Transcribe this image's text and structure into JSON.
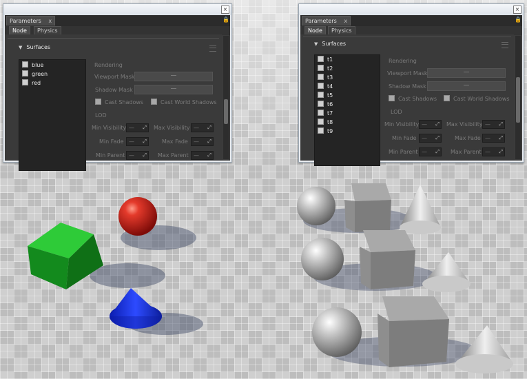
{
  "left_window": {
    "tab_title": "Parameters",
    "tab_close": "x",
    "subtabs": [
      "Node",
      "Physics"
    ],
    "section_title": "Surfaces",
    "surfaces": [
      "blue",
      "green",
      "red"
    ],
    "rendering_label": "Rendering",
    "viewport_mask_label": "Viewport Mask",
    "shadow_mask_label": "Shadow Mask",
    "cast_shadows_label": "Cast Shadows",
    "cast_world_shadows_label": "Cast World Shadows",
    "lod_label": "LOD",
    "min_visibility_label": "Min Visibility",
    "max_visibility_label": "Max Visibility",
    "min_fade_label": "Min Fade",
    "max_fade_label": "Max Fade",
    "min_parent_label": "Min Parent",
    "max_parent_label": "Max Parent",
    "spin_value": "—"
  },
  "right_window": {
    "tab_title": "Parameters",
    "tab_close": "x",
    "subtabs": [
      "Node",
      "Physics"
    ],
    "section_title": "Surfaces",
    "surfaces": [
      "t1",
      "t2",
      "t3",
      "t4",
      "t5",
      "t6",
      "t7",
      "t8",
      "t9"
    ],
    "rendering_label": "Rendering",
    "viewport_mask_label": "Viewport Mask",
    "shadow_mask_label": "Shadow Mask",
    "cast_shadows_label": "Cast Shadows",
    "cast_world_shadows_label": "Cast World Shadows",
    "lod_label": "LOD",
    "min_visibility_label": "Min Visibility",
    "max_visibility_label": "Max Visibility",
    "min_fade_label": "Min Fade",
    "max_fade_label": "Max Fade",
    "min_parent_label": "Min Parent",
    "max_parent_label": "Max Parent",
    "spin_value": "—"
  },
  "colors": {
    "sphere_red": "#d21b16",
    "cube_green": "#169d24",
    "cone_blue": "#1630d6",
    "metal": "#b9b9b9"
  }
}
